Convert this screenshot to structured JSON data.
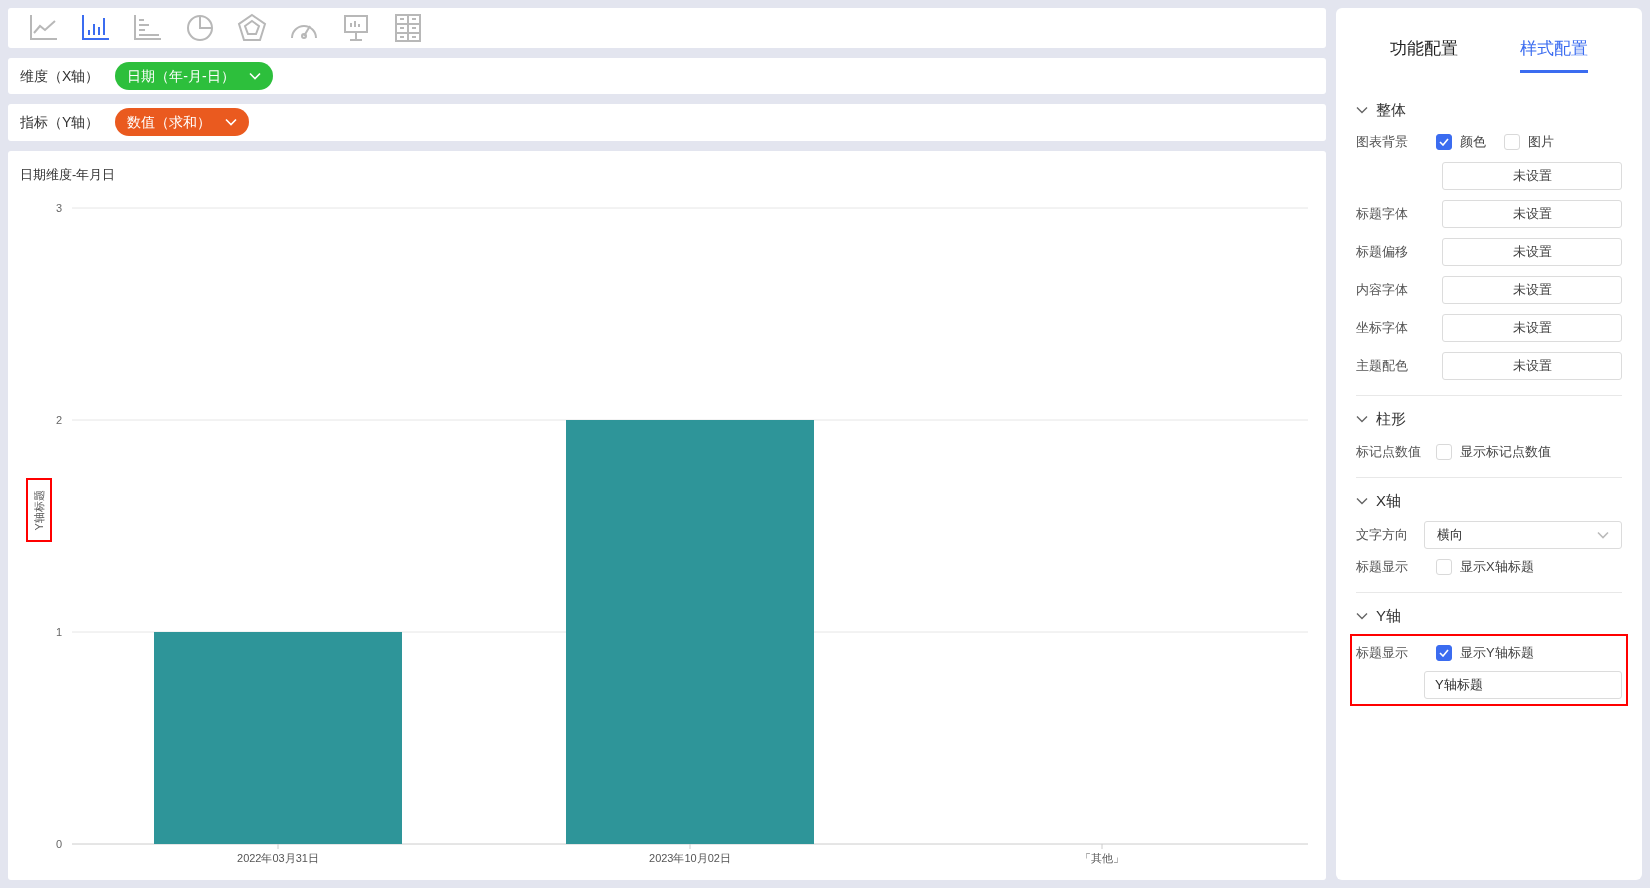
{
  "chart_types": [
    {
      "kind": "line",
      "selected": false
    },
    {
      "kind": "bar",
      "selected": true
    },
    {
      "kind": "hbar",
      "selected": false
    },
    {
      "kind": "pie",
      "selected": false
    },
    {
      "kind": "radar",
      "selected": false
    },
    {
      "kind": "gauge",
      "selected": false
    },
    {
      "kind": "board",
      "selected": false
    },
    {
      "kind": "table",
      "selected": false
    }
  ],
  "dimension": {
    "label": "维度（X轴）",
    "value": "日期（年-月-日）",
    "color": "#2dbf3c"
  },
  "measure": {
    "label": "指标（Y轴）",
    "value": "数值（求和）",
    "color": "#ea5a1f"
  },
  "chart": {
    "title": "日期维度-年月日",
    "y_title": "Y轴标题",
    "y_title_highlighted": true,
    "chart_data": {
      "type": "bar",
      "categories": [
        "2022年03月31日",
        "2023年10月02日",
        "「其他」"
      ],
      "series": [
        {
          "color": "#2e9599",
          "values": [
            1,
            2,
            null
          ]
        }
      ],
      "yticks": [
        0,
        1,
        2,
        3
      ],
      "ylim": [
        0,
        3
      ]
    }
  },
  "tabs": [
    {
      "label": "功能配置",
      "selected": false
    },
    {
      "label": "样式配置",
      "selected": true
    }
  ],
  "sections": [
    {
      "title": "整体",
      "expanded": true,
      "highlighted": false,
      "rows": [
        {
          "kind": "checks",
          "label": "图表背景",
          "options": [
            {
              "label": "颜色",
              "checked": true
            },
            {
              "label": "图片",
              "checked": false
            }
          ]
        },
        {
          "kind": "button",
          "value": "未设置"
        },
        {
          "kind": "button",
          "label": "标题字体",
          "value": "未设置"
        },
        {
          "kind": "button",
          "label": "标题偏移",
          "value": "未设置"
        },
        {
          "kind": "button",
          "label": "内容字体",
          "value": "未设置"
        },
        {
          "kind": "button",
          "label": "坐标字体",
          "value": "未设置"
        },
        {
          "kind": "button",
          "label": "主题配色",
          "value": "未设置"
        }
      ]
    },
    {
      "title": "柱形",
      "expanded": true,
      "highlighted": false,
      "rows": [
        {
          "kind": "checks",
          "label": "标记点数值",
          "options": [
            {
              "label": "显示标记点数值",
              "checked": false
            }
          ]
        }
      ]
    },
    {
      "title": "X轴",
      "expanded": true,
      "highlighted": false,
      "rows": [
        {
          "kind": "select",
          "label": "文字方向",
          "value": "横向"
        },
        {
          "kind": "checks",
          "label": "标题显示",
          "options": [
            {
              "label": "显示X轴标题",
              "checked": false
            }
          ]
        }
      ]
    },
    {
      "title": "Y轴",
      "expanded": true,
      "highlighted": true,
      "rows": [
        {
          "kind": "checks",
          "label": "标题显示",
          "options": [
            {
              "label": "显示Y轴标题",
              "checked": true
            }
          ]
        },
        {
          "kind": "input",
          "value": "Y轴标题"
        }
      ]
    }
  ]
}
